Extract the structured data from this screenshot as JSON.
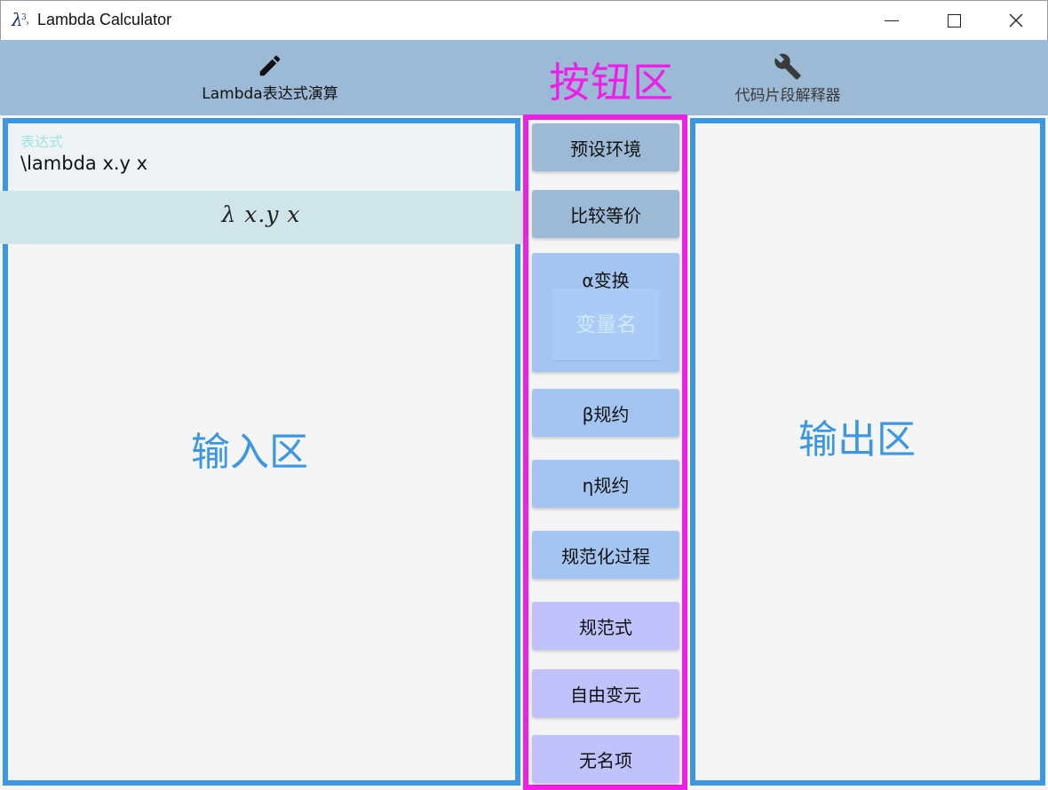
{
  "window": {
    "title": "Lambda Calculator",
    "icon": "lambda-app-icon"
  },
  "toolbar": {
    "lambda_tab": {
      "label": "Lambda表达式演算",
      "icon": "pencil-icon"
    },
    "interpreter_tab": {
      "label": "代码片段解释器",
      "icon": "wrench-icon"
    },
    "button_area_label": "按钮区"
  },
  "input_panel": {
    "field_caption": "表达式",
    "field_value": "\\lambda x.y x",
    "rendered_expression": "λ x.y x",
    "area_label": "输入区"
  },
  "buttons": {
    "preset_env": "预设环境",
    "compare_equiv": "比较等价",
    "alpha_convert": "α变换",
    "variable_name_placeholder": "变量名",
    "beta_reduce": "β规约",
    "eta_reduce": "η规约",
    "normalize_process": "规范化过程",
    "normal_form": "规范式",
    "free_vars": "自由变元",
    "nameless_term": "无名项"
  },
  "output_panel": {
    "area_label": "输出区"
  },
  "colors": {
    "toolbar": "#9cb9d6",
    "panel_border": "#3b97e3",
    "button_area_border": "#ef1fe6",
    "button_steel": "#9cb9d6",
    "button_blue": "#a4c5f2",
    "button_violet": "#c0c3fb"
  }
}
